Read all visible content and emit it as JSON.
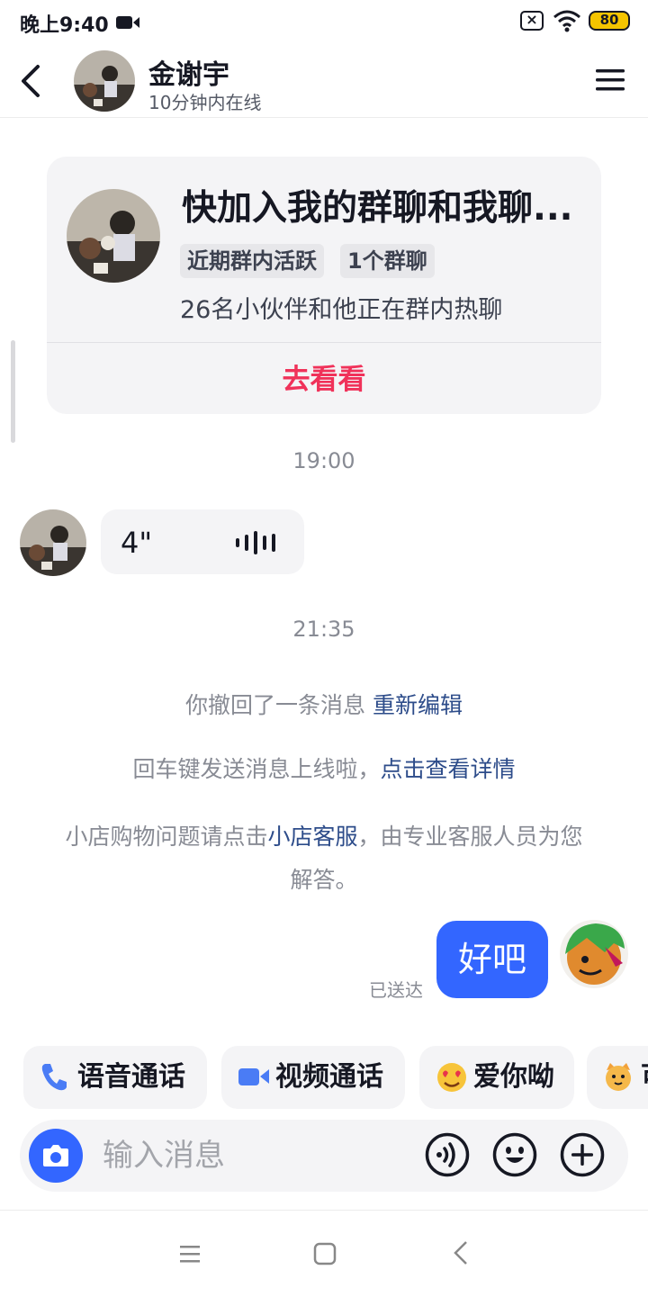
{
  "status_bar": {
    "time": "晚上9:40",
    "battery": "80",
    "battery_color": "#f5c400"
  },
  "header": {
    "contact_name": "金谢宇",
    "contact_status": "10分钟内在线"
  },
  "group_card": {
    "title": "快加入我的群聊和我聊...",
    "tags": [
      "近期群内活跃",
      "1个群聊"
    ],
    "description": "26名小伙伴和他正在群内热聊",
    "action": "去看看",
    "action_color": "#f0325a"
  },
  "messages": {
    "timestamp_1": "19:00",
    "voice_duration": "4\"",
    "timestamp_2": "21:35",
    "recall_text": "你撤回了一条消息",
    "recall_link": "重新编辑",
    "enter_text": "回车键发送消息上线啦，",
    "enter_link": "点击查看详情",
    "shop_text_1": "小店购物问题请点击",
    "shop_link": "小店客服",
    "shop_text_2": "，由专业客服人员为您解答。",
    "outgoing_text": "好吧",
    "outgoing_status": "已送达",
    "outgoing_color": "#3366ff"
  },
  "quick_actions": [
    "语音通话",
    "视频通话",
    "爱你呦",
    "可"
  ],
  "input": {
    "placeholder": "输入消息"
  },
  "icons": [
    "camera-icon",
    "voice-icon",
    "emoji-icon",
    "plus-icon",
    "phone-icon",
    "video-icon"
  ]
}
